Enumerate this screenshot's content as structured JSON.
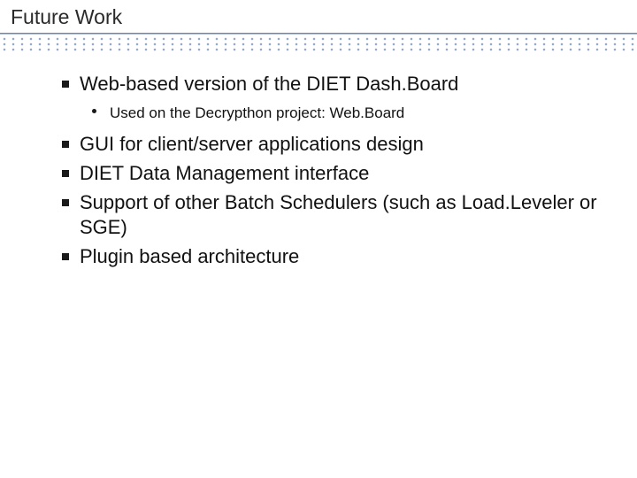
{
  "slide": {
    "title": "Future Work",
    "bullets": [
      {
        "text": "Web-based version of the DIET Dash.Board",
        "sub": [
          "Used on the Decrypthon project: Web.Board"
        ]
      },
      {
        "text": "GUI for client/server applications design"
      },
      {
        "text": "DIET Data Management interface"
      },
      {
        "text": "Support of other Batch Schedulers (such as Load.Leveler or SGE)"
      },
      {
        "text": "Plugin based architecture"
      }
    ]
  }
}
